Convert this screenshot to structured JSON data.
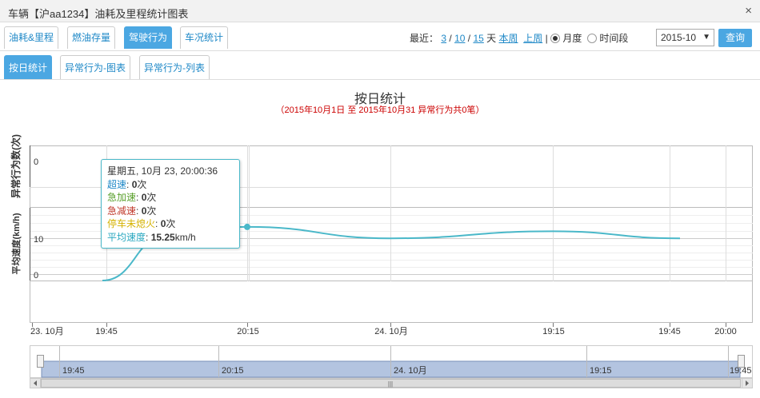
{
  "window": {
    "title": "车辆【沪aa1234】油耗及里程统计图表",
    "close": "×"
  },
  "tabs_top": [
    {
      "label": "油耗&里程",
      "active": false
    },
    {
      "label": "燃油存量",
      "active": false
    },
    {
      "label": "驾驶行为",
      "active": true
    },
    {
      "label": "车况统计",
      "active": false
    }
  ],
  "tabs_sub": [
    {
      "label": "按日统计",
      "active": true
    },
    {
      "label": "异常行为-图表",
      "active": false
    },
    {
      "label": "异常行为-列表",
      "active": false
    }
  ],
  "controls": {
    "recent_label": "最近：",
    "d3": "3",
    "d10": "10",
    "d15": "15",
    "sep": "/",
    "day_unit": "天",
    "this_week": "本周",
    "last_week": "上周",
    "bar": "|",
    "month_label": "月度",
    "period_label": "时间段",
    "month_value": "2015-10",
    "query_button": "查询",
    "period_mode": "month"
  },
  "chart": {
    "title": "按日统计",
    "subtitle": "（2015年10月1日 至 2015年10月31 异常行为共0笔）",
    "y1_label": "异常行为数(次)",
    "y2_label": "平均速度(km/h)",
    "y1_tick": "0",
    "y2_ticks": [
      "10",
      "0"
    ],
    "x_ticks": [
      "23. 10月",
      "19:45",
      "20:15",
      "24. 10月",
      "19:15",
      "19:45",
      "20:00"
    ],
    "nav_ticks": [
      "19:45",
      "20:15",
      "24. 10月",
      "19:15",
      "19:45"
    ],
    "scroll_mid": "|||",
    "line_color": "#4ab8c9"
  },
  "tooltip": {
    "header": "星期五, 10月 23, 20:00:36",
    "rows": [
      {
        "name": "超速",
        "value": "0",
        "unit": "次",
        "color": "#1e88c7"
      },
      {
        "name": "急加速",
        "value": "0",
        "unit": "次",
        "color": "#5aa02c"
      },
      {
        "name": "急减速",
        "value": "0",
        "unit": "次",
        "color": "#c0392b"
      },
      {
        "name": "停车未熄火",
        "value": "0",
        "unit": "次",
        "color": "#d4b200"
      },
      {
        "name": "平均速度",
        "value": "15.25",
        "unit": "km/h",
        "color": "#2aa8c0"
      }
    ]
  },
  "chart_data": {
    "type": "line",
    "title": "按日统计",
    "ylabel": "平均速度(km/h)",
    "series": [
      {
        "name": "平均速度",
        "x": [
          "19:45",
          "20:00",
          "20:15",
          "24. 10月",
          "19:15",
          "19:45"
        ],
        "values": [
          0,
          13,
          15.25,
          12,
          14,
          12
        ]
      }
    ]
  }
}
